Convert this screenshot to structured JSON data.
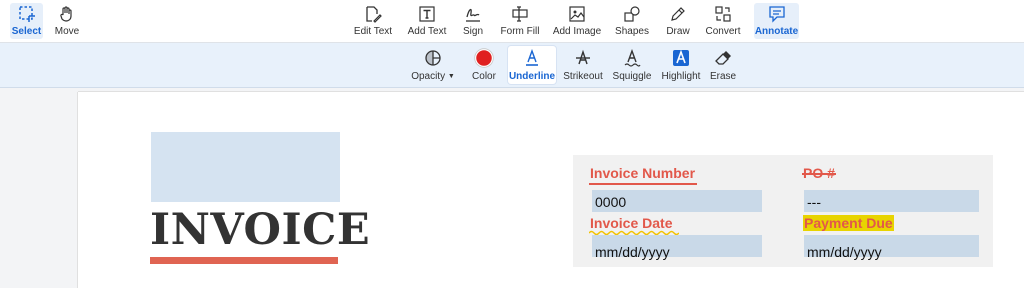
{
  "toolbar": {
    "items": [
      {
        "label": "Select",
        "icon": "select-icon"
      },
      {
        "label": "Move",
        "icon": "hand-icon"
      },
      {
        "label": "Edit Text",
        "icon": "edit-text-icon"
      },
      {
        "label": "Add Text",
        "icon": "add-text-icon"
      },
      {
        "label": "Sign",
        "icon": "signature-icon"
      },
      {
        "label": "Form Fill",
        "icon": "form-fill-icon"
      },
      {
        "label": "Add Image",
        "icon": "image-icon"
      },
      {
        "label": "Shapes",
        "icon": "shapes-icon"
      },
      {
        "label": "Draw",
        "icon": "pencil-icon"
      },
      {
        "label": "Convert",
        "icon": "convert-icon"
      },
      {
        "label": "Annotate",
        "icon": "comment-icon"
      }
    ],
    "active": [
      "Select",
      "Annotate"
    ]
  },
  "annotate_bar": {
    "items": [
      {
        "label": "Opacity",
        "icon": "opacity-icon",
        "has_dropdown": true
      },
      {
        "label": "Color",
        "icon": "color-dot-icon"
      },
      {
        "label": "Underline",
        "icon": "underline-icon"
      },
      {
        "label": "Strikeout",
        "icon": "strikeout-icon"
      },
      {
        "label": "Squiggle",
        "icon": "squiggle-icon"
      },
      {
        "label": "Highlight",
        "icon": "highlight-icon"
      },
      {
        "label": "Erase",
        "icon": "eraser-icon"
      }
    ],
    "active": "Underline"
  },
  "colors": {
    "accent": "#1a66d2",
    "annotation_color": "#e02020",
    "label_red": "#e2584a",
    "field_bg": "#c9d9e8",
    "highlight": "#e8d400",
    "squiggle": "#f2c200"
  },
  "document": {
    "title": "INVOICE",
    "fields": {
      "invoice_number": {
        "label": "Invoice Number",
        "value": "0000",
        "annotation": "underline"
      },
      "po": {
        "label": "PO #",
        "value": "---",
        "annotation": "strikeout"
      },
      "invoice_date": {
        "label": "Invoice Date",
        "value": "mm/dd/yyyy",
        "annotation": "squiggle"
      },
      "payment_due": {
        "label": "Payment Due",
        "value": "mm/dd/yyyy",
        "annotation": "highlight"
      }
    }
  }
}
